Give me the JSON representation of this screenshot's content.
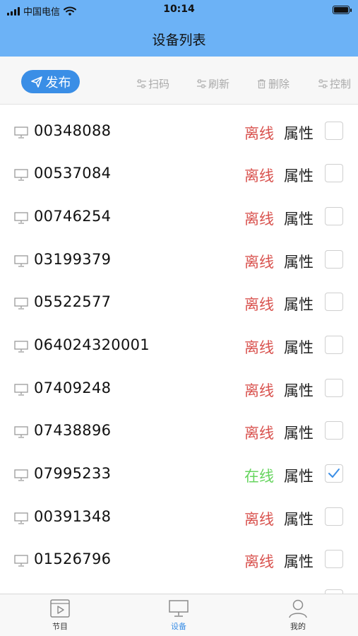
{
  "status_bar": {
    "carrier": "中国电信",
    "time": "10:14"
  },
  "header": {
    "title": "设备列表"
  },
  "toolbar": {
    "publish_label": "发布",
    "tools": [
      {
        "label": "扫码",
        "icon": "sliders-icon"
      },
      {
        "label": "刷新",
        "icon": "sliders-icon"
      },
      {
        "label": "删除",
        "icon": "trash-icon"
      },
      {
        "label": "控制",
        "icon": "sliders-icon"
      }
    ]
  },
  "devices": {
    "property_label": "属性",
    "items": [
      {
        "id": "00348088",
        "status": "离线",
        "online": false,
        "checked": false
      },
      {
        "id": "00537084",
        "status": "离线",
        "online": false,
        "checked": false
      },
      {
        "id": "00746254",
        "status": "离线",
        "online": false,
        "checked": false
      },
      {
        "id": "03199379",
        "status": "离线",
        "online": false,
        "checked": false
      },
      {
        "id": "05522577",
        "status": "离线",
        "online": false,
        "checked": false
      },
      {
        "id": "064024320001",
        "status": "离线",
        "online": false,
        "checked": false
      },
      {
        "id": "07409248",
        "status": "离线",
        "online": false,
        "checked": false
      },
      {
        "id": "07438896",
        "status": "离线",
        "online": false,
        "checked": false
      },
      {
        "id": "07995233",
        "status": "在线",
        "online": true,
        "checked": true
      },
      {
        "id": "00391348",
        "status": "离线",
        "online": false,
        "checked": false
      },
      {
        "id": "01526796",
        "status": "离线",
        "online": false,
        "checked": false
      }
    ]
  },
  "colors": {
    "accent": "#3a8ee6",
    "header_bg": "#6cb2f6",
    "offline": "#d9534f",
    "online": "#66d45e"
  },
  "tabbar": {
    "tabs": [
      {
        "label": "节目",
        "icon": "play-screen-icon",
        "active": false
      },
      {
        "label": "设备",
        "icon": "monitor-icon",
        "active": true
      },
      {
        "label": "我的",
        "icon": "person-icon",
        "active": false
      }
    ]
  }
}
